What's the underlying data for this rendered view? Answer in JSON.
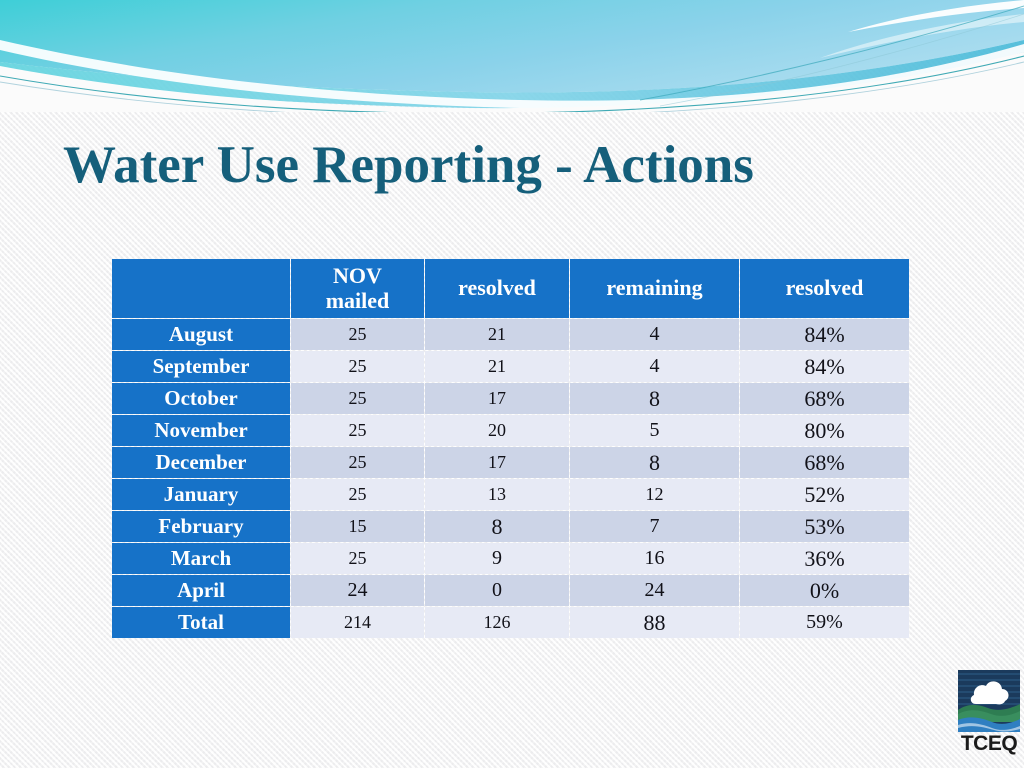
{
  "slide": {
    "title": "Water Use Reporting - Actions",
    "background_color": "#f6f6f6",
    "accent_color": "#1672c8",
    "title_color": "#155f7b",
    "banner": {
      "name": "wave-banner",
      "gradient_from": "#3fd0d8",
      "gradient_to": "#8fd4ea"
    }
  },
  "table": {
    "name": "water-use-reporting-actions-table",
    "header_background": "#1672c8",
    "row_stripe_dark": "#ccd4e7",
    "row_stripe_light": "#e7eaf5",
    "columns": [
      {
        "label": "",
        "key": "month"
      },
      {
        "label": "NOV mailed",
        "key": "nov_mailed",
        "line1": "NOV",
        "line2": "mailed"
      },
      {
        "label": "resolved",
        "key": "resolved"
      },
      {
        "label": "remaining",
        "key": "remaining"
      },
      {
        "label": "resolved",
        "key": "resolved_pct"
      }
    ],
    "rows": [
      {
        "month": "August",
        "nov_mailed": "25",
        "resolved": "21",
        "remaining": "4",
        "resolved_pct": "84%"
      },
      {
        "month": "September",
        "nov_mailed": "25",
        "resolved": "21",
        "remaining": "4",
        "resolved_pct": "84%"
      },
      {
        "month": "October",
        "nov_mailed": "25",
        "resolved": "17",
        "remaining": "8",
        "resolved_pct": "68%"
      },
      {
        "month": "November",
        "nov_mailed": "25",
        "resolved": "20",
        "remaining": "5",
        "resolved_pct": "80%"
      },
      {
        "month": "December",
        "nov_mailed": "25",
        "resolved": "17",
        "remaining": "8",
        "resolved_pct": "68%"
      },
      {
        "month": "January",
        "nov_mailed": "25",
        "resolved": "13",
        "remaining": "12",
        "resolved_pct": "52%"
      },
      {
        "month": "February",
        "nov_mailed": "15",
        "resolved": "8",
        "remaining": "7",
        "resolved_pct": "53%"
      },
      {
        "month": "March",
        "nov_mailed": "25",
        "resolved": "9",
        "remaining": "16",
        "resolved_pct": "36%"
      },
      {
        "month": "April",
        "nov_mailed": "24",
        "resolved": "0",
        "remaining": "24",
        "resolved_pct": "0%"
      },
      {
        "month": "Total",
        "nov_mailed": "214",
        "resolved": "126",
        "remaining": "88",
        "resolved_pct": "59%"
      }
    ]
  },
  "logo": {
    "name": "tceq-logo",
    "wordmark": "TCEQ",
    "sky_color": "#1b3a5c",
    "cloud_color": "#ffffff",
    "hill_color": "#2e7d52",
    "water_color": "#2f7fc1"
  },
  "chart_data": {
    "type": "table",
    "title": "Water Use Reporting - Actions",
    "columns": [
      "month",
      "NOV mailed",
      "resolved",
      "remaining",
      "resolved %"
    ],
    "categories": [
      "August",
      "September",
      "October",
      "November",
      "December",
      "January",
      "February",
      "March",
      "April",
      "Total"
    ],
    "series": [
      {
        "name": "NOV mailed",
        "values": [
          25,
          25,
          25,
          25,
          25,
          25,
          15,
          25,
          24,
          214
        ]
      },
      {
        "name": "resolved",
        "values": [
          21,
          21,
          17,
          20,
          17,
          13,
          8,
          9,
          0,
          126
        ]
      },
      {
        "name": "remaining",
        "values": [
          4,
          4,
          8,
          5,
          8,
          12,
          7,
          16,
          24,
          88
        ]
      },
      {
        "name": "resolved %",
        "values": [
          84,
          84,
          68,
          80,
          68,
          52,
          53,
          36,
          0,
          59
        ]
      }
    ]
  }
}
